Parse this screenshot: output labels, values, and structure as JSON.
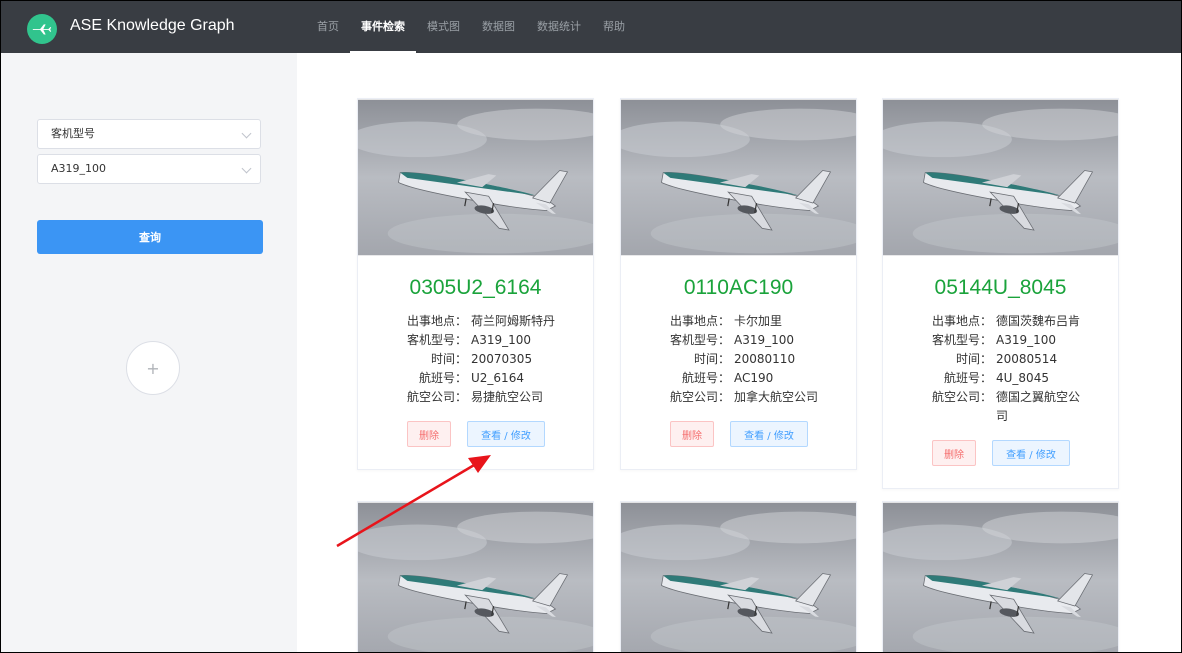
{
  "header": {
    "brand": "ASE Knowledge Graph",
    "nav": [
      "首页",
      "事件检索",
      "模式图",
      "数据图",
      "数据统计",
      "帮助"
    ],
    "active_nav": "事件检索"
  },
  "sidebar": {
    "select_type": "客机型号",
    "select_model": "A319_100",
    "query_label": "查询",
    "add_label": "+"
  },
  "cards": [
    {
      "title": "0305U2_6164",
      "location_label": "出事地点：",
      "location": "荷兰阿姆斯特丹",
      "model_label": "客机型号：",
      "model": "A319_100",
      "time_label": "时间：",
      "time": "20070305",
      "flight_label": "航班号：",
      "flight": "U2_6164",
      "airline_label": "航空公司：",
      "airline": "易捷航空公司",
      "delete_label": "删除",
      "view_label": "查看 / 修改"
    },
    {
      "title": "0110AC190",
      "location_label": "出事地点：",
      "location": "卡尔加里",
      "model_label": "客机型号：",
      "model": "A319_100",
      "time_label": "时间：",
      "time": "20080110",
      "flight_label": "航班号：",
      "flight": "AC190",
      "airline_label": "航空公司：",
      "airline": "加拿大航空公司",
      "delete_label": "删除",
      "view_label": "查看 / 修改"
    },
    {
      "title": "05144U_8045",
      "location_label": "出事地点：",
      "location": "德国茨魏布吕肯",
      "model_label": "客机型号：",
      "model": "A319_100",
      "time_label": "时间：",
      "time": "20080514",
      "flight_label": "航班号：",
      "flight": "4U_8045",
      "airline_label": "航空公司：",
      "airline": "德国之翼航空公司",
      "delete_label": "删除",
      "view_label": "查看 / 修改"
    }
  ],
  "colors": {
    "header_bg": "#393d43",
    "title_green": "#1aa33b",
    "primary_blue": "#3b95f4",
    "danger_red": "#f56c6c",
    "annotation_arrow": "#e8141b"
  }
}
